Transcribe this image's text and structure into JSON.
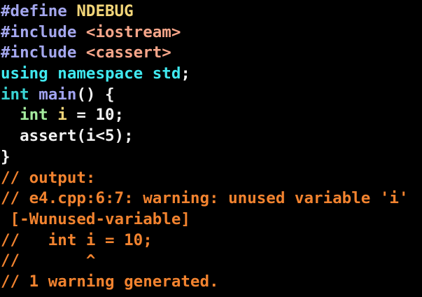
{
  "editor": {
    "colors": {
      "background": "#000000",
      "preprocessor": "#a4a7ee",
      "macro": "#f3d679",
      "include_path": "#f7a68a",
      "keyword": "#40e9f0",
      "type": "#3ad3d3",
      "function": "#a1a3f1",
      "variable": "#a5eb9e",
      "number": "#f7f7f7",
      "plain": "#f2f2f2",
      "comment": "#f2832f"
    },
    "lines": [
      {
        "tokens": [
          {
            "text": "#define ",
            "kind": "preprocessor"
          },
          {
            "text": "NDEBUG",
            "kind": "macro"
          }
        ]
      },
      {
        "tokens": [
          {
            "text": "#include ",
            "kind": "preprocessor"
          },
          {
            "text": "<iostream>",
            "kind": "include_path"
          }
        ]
      },
      {
        "tokens": [
          {
            "text": "#include ",
            "kind": "preprocessor"
          },
          {
            "text": "<cassert>",
            "kind": "include_path"
          }
        ]
      },
      {
        "tokens": [
          {
            "text": "using namespace std",
            "kind": "keyword"
          },
          {
            "text": ";",
            "kind": "plain"
          }
        ]
      },
      {
        "tokens": [
          {
            "text": "int",
            "kind": "type"
          },
          {
            "text": " ",
            "kind": "plain"
          },
          {
            "text": "main",
            "kind": "function"
          },
          {
            "text": "() {",
            "kind": "plain"
          }
        ]
      },
      {
        "tokens": [
          {
            "text": "  ",
            "kind": "plain"
          },
          {
            "text": "int",
            "kind": "variable"
          },
          {
            "text": " ",
            "kind": "plain"
          },
          {
            "text": "i",
            "kind": "macro"
          },
          {
            "text": " = 10;",
            "kind": "plain"
          }
        ]
      },
      {
        "tokens": [
          {
            "text": "  assert(i<5);",
            "kind": "plain"
          }
        ]
      },
      {
        "tokens": [
          {
            "text": "}",
            "kind": "plain"
          }
        ]
      },
      {
        "tokens": [
          {
            "text": "// output:",
            "kind": "comment"
          }
        ]
      },
      {
        "tokens": [
          {
            "text": "// e4.cpp:6:7: warning: unused variable 'i'",
            "kind": "comment"
          }
        ]
      },
      {
        "tokens": [
          {
            "text": " [-Wunused-variable]",
            "kind": "comment"
          }
        ]
      },
      {
        "tokens": [
          {
            "text": "//   int i = 10;",
            "kind": "comment"
          }
        ]
      },
      {
        "tokens": [
          {
            "text": "//       ^",
            "kind": "comment"
          }
        ]
      },
      {
        "tokens": [
          {
            "text": "// 1 warning generated.",
            "kind": "comment"
          }
        ]
      }
    ]
  }
}
